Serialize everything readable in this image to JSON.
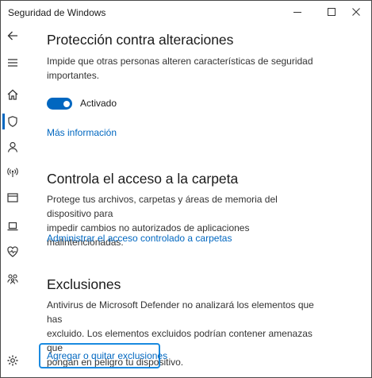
{
  "window": {
    "title": "Seguridad de Windows",
    "buttons": [
      "minimize-icon",
      "maximize-icon",
      "close-icon"
    ]
  },
  "sidebar": {
    "items": [
      {
        "icon": "back-arrow-icon"
      },
      {
        "icon": "hamburger-menu-icon"
      },
      {
        "icon": "home-icon"
      },
      {
        "icon": "shield-icon",
        "active": true
      },
      {
        "icon": "person-icon"
      },
      {
        "icon": "wifi-antenna-icon"
      },
      {
        "icon": "app-browser-icon"
      },
      {
        "icon": "laptop-icon"
      },
      {
        "icon": "heart-health-icon"
      },
      {
        "icon": "family-icon"
      },
      {
        "icon": "gear-icon"
      }
    ]
  },
  "tamper": {
    "heading": "Protección contra alteraciones",
    "line1": "Impide que otras personas alteren características de seguridad",
    "line2": "importantes.",
    "toggle_state": "Activado",
    "toggle_on": true,
    "link": "Más información"
  },
  "folder": {
    "heading": "Controla el acceso a la carpeta",
    "line1": "Protege tus archivos, carpetas y áreas de memoria del dispositivo para",
    "line2": "impedir cambios no autorizados de aplicaciones malintencionadas.",
    "link": "Administrar el acceso controlado a carpetas"
  },
  "exclusions": {
    "heading": "Exclusiones",
    "line1": "Antivirus de Microsoft Defender no analizará los elementos que has",
    "line2": "excluido. Los elementos excluidos podrían contener amenazas que",
    "line3": "pongan en peligro tu dispositivo.",
    "link": "Agregar o quitar exclusiones"
  },
  "colors": {
    "accent": "#0067c0",
    "focus": "#1a8ae0",
    "text": "#1a1a1a"
  }
}
